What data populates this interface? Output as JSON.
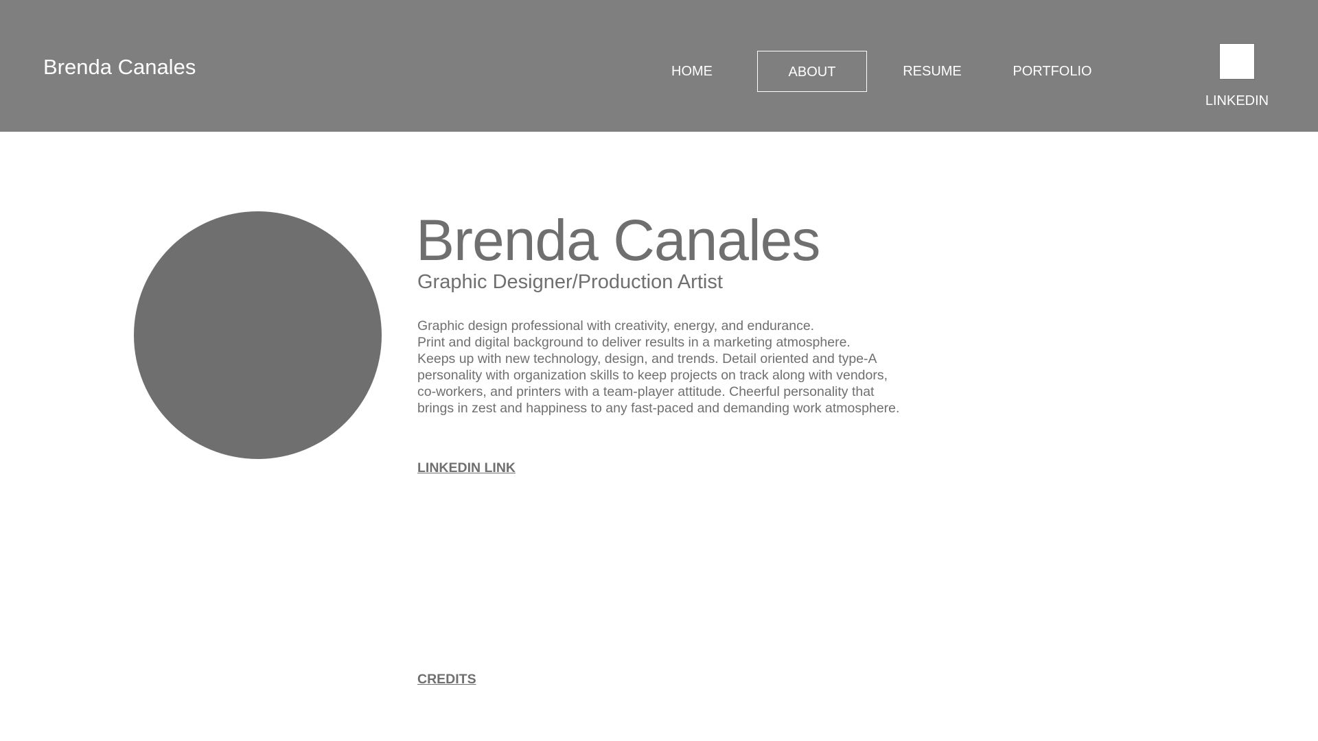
{
  "header": {
    "site_title": "Brenda Canales",
    "nav": [
      {
        "label": "HOME"
      },
      {
        "label": "ABOUT",
        "active": true
      },
      {
        "label": "RESUME"
      },
      {
        "label": "PORTFOLIO"
      }
    ],
    "linkedin": {
      "label": "LINKEDIN",
      "icon": "linkedin-icon-placeholder"
    }
  },
  "main": {
    "name": "Brenda Canales",
    "subtitle": "Graphic Designer/Production Artist",
    "bio_lines": [
      "Graphic design professional with creativity, energy, and endurance.",
      "Print and digital background to deliver results in a marketing atmosphere.",
      "Keeps up with new technology, design, and trends. Detail oriented and type-A",
      "personality with organization skills to keep projects on track along with vendors,",
      "co-workers, and printers with a team-player attitude. Cheerful personality that",
      "brings in zest and happiness to any fast-paced and demanding work atmosphere."
    ],
    "linkedin_link": "LINKEDIN LINK",
    "credits_link": "CREDITS"
  },
  "colors": {
    "header_bg": "#7f7f7f",
    "text_gray": "#6f6f6f",
    "avatar_gray": "#6f6f6f",
    "white": "#ffffff"
  }
}
